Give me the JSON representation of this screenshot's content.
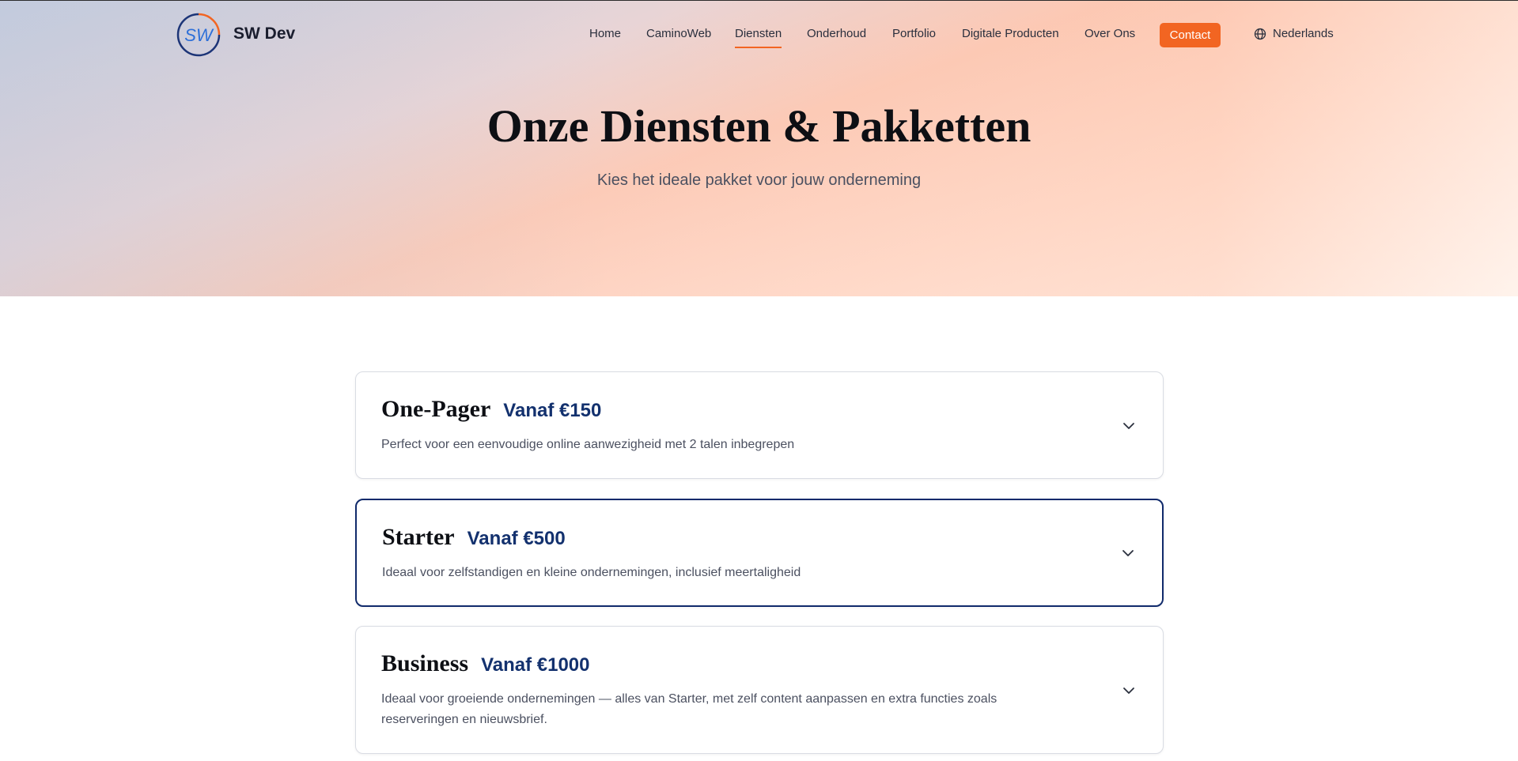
{
  "brand": {
    "name": "SW Dev",
    "logo_text": "SW"
  },
  "nav": {
    "items": [
      {
        "label": "Home"
      },
      {
        "label": "CaminoWeb"
      },
      {
        "label": "Diensten",
        "active": true
      },
      {
        "label": "Onderhoud"
      },
      {
        "label": "Portfolio"
      },
      {
        "label": "Digitale Producten"
      },
      {
        "label": "Over Ons"
      }
    ],
    "contact_label": "Contact",
    "language": {
      "label": "Nederlands",
      "icon": "globe-icon"
    }
  },
  "hero": {
    "title": "Onze Diensten & Pakketten",
    "subtitle": "Kies het ideale pakket voor jouw onderneming"
  },
  "packages": [
    {
      "name": "One-Pager",
      "price": "Vanaf €150",
      "description": "Perfect voor een eenvoudige online aanwezigheid met 2 talen inbegrepen"
    },
    {
      "name": "Starter",
      "price": "Vanaf €500",
      "description": "Ideaal voor zelfstandigen en kleine ondernemingen, inclusief meertaligheid",
      "selected": true
    },
    {
      "name": "Business",
      "price": "Vanaf €1000",
      "description": "Ideaal voor groeiende ondernemingen — alles van Starter, met zelf content aanpassen en extra functies zoals reserveringen en nieuwsbrief."
    }
  ],
  "colors": {
    "accent": "#f26522",
    "brand_blue": "#13316e",
    "selected_border": "#102a6b"
  }
}
